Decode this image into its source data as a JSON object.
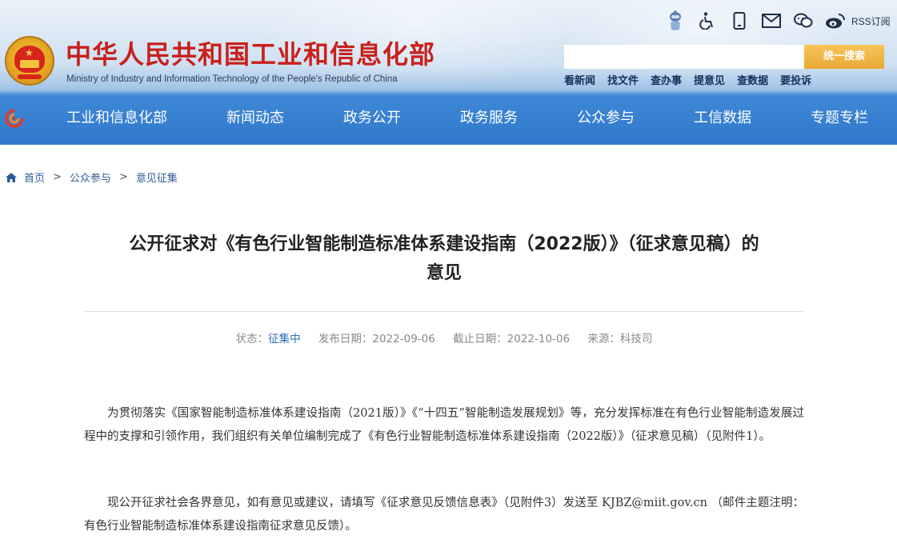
{
  "header": {
    "site_title": "中华人民共和国工业和信息化部",
    "site_subtitle": "Ministry of Industry and Information Technology of the People's Republic of China",
    "rss_label": "RSS订阅",
    "search": {
      "placeholder": "",
      "button_label": "统一搜索"
    },
    "quick_links": [
      "看新闻",
      "找文件",
      "查办事",
      "提意见",
      "查数据",
      "要投诉"
    ],
    "nav": [
      "工业和信息化部",
      "新闻动态",
      "政务公开",
      "政务服务",
      "公众参与",
      "工信数据",
      "专题专栏"
    ]
  },
  "breadcrumb": {
    "items": [
      "首页",
      "公众参与",
      "意见征集"
    ],
    "separator": ">"
  },
  "article": {
    "title_line1": "公开征求对《有色行业智能制造标准体系建设指南（2022版）》（征求意见稿）的",
    "title_line2": "意见",
    "meta": {
      "status_label": "状态：",
      "status_value": "征集中",
      "publish_label": "发布日期：",
      "publish_date": "2022-09-06",
      "deadline_label": "截止日期：",
      "deadline_date": "2022-10-06",
      "source_label": "来源：",
      "source_value": "科技司"
    },
    "paragraphs": [
      "为贯彻落实《国家智能制造标准体系建设指南（2021版）》《“十四五”智能制造发展规划》等，充分发挥标准在有色行业智能制造发展过程中的支撑和引领作用，我们组织有关单位编制完成了《有色行业智能制造标准体系建设指南（2022版）》（征求意见稿）（见附件1）。",
      "现公开征求社会各界意见，如有意见或建议，请填写《征求意见反馈信息表》（见附件3）发送至 KJBZ@miit.gov.cn （邮件主题注明：有色行业智能制造标准体系建设指南征求意见反馈）。"
    ]
  },
  "colors": {
    "brand_red": "#c8201c",
    "nav_blue": "#2f78cc",
    "search_orange": "#eaa936",
    "link_blue": "#2d5b96"
  },
  "icons": [
    "robot-icon",
    "accessibility-icon",
    "mobile-icon",
    "mail-icon",
    "wechat-icon",
    "weibo-icon",
    "home-icon"
  ]
}
